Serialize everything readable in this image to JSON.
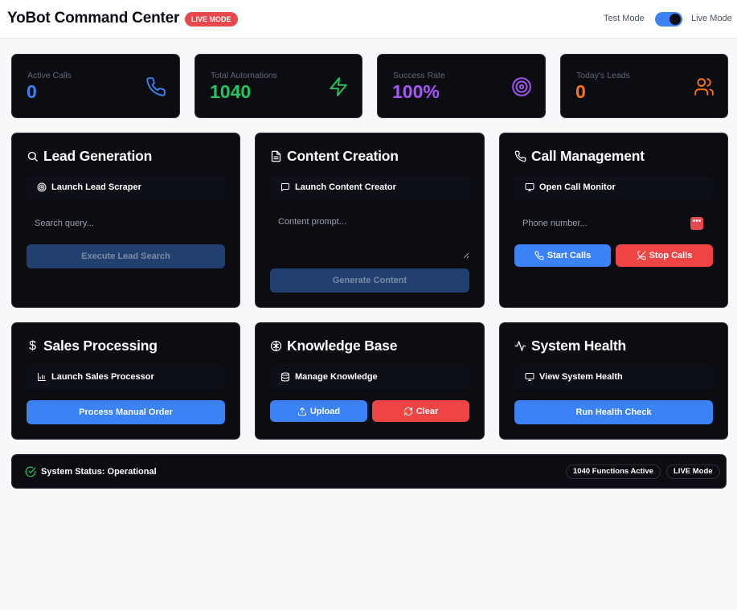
{
  "header": {
    "title": "YoBot Command Center",
    "badge": "LIVE MODE",
    "test_mode_label": "Test Mode",
    "live_mode_label": "Live Mode"
  },
  "stats": [
    {
      "label": "Active Calls",
      "value": "0",
      "color": "#3b82f6",
      "icon": "phone-icon"
    },
    {
      "label": "Total Automations",
      "value": "1040",
      "color": "#22c55e",
      "icon": "lightning-icon"
    },
    {
      "label": "Success Rate",
      "value": "100%",
      "color": "#a855f7",
      "icon": "target-icon"
    },
    {
      "label": "Today's Leads",
      "value": "0",
      "color": "#f97316",
      "icon": "users-icon"
    }
  ],
  "lead_generation": {
    "title": "Lead Generation",
    "launch": "Launch Lead Scraper",
    "search_placeholder": "Search query...",
    "execute": "Execute Lead Search"
  },
  "content_creation": {
    "title": "Content Creation",
    "launch": "Launch Content Creator",
    "prompt_placeholder": "Content prompt...",
    "generate": "Generate Content"
  },
  "call_management": {
    "title": "Call Management",
    "launch": "Open Call Monitor",
    "phone_placeholder": "Phone number...",
    "start": "Start Calls",
    "stop": "Stop Calls"
  },
  "sales_processing": {
    "title": "Sales Processing",
    "launch": "Launch Sales Processor",
    "process": "Process Manual Order"
  },
  "knowledge_base": {
    "title": "Knowledge Base",
    "launch": "Manage Knowledge",
    "upload": "Upload",
    "clear": "Clear"
  },
  "system_health": {
    "title": "System Health",
    "launch": "View System Health",
    "run": "Run Health Check"
  },
  "status_bar": {
    "status": "System Status: Operational",
    "functions": "1040 Functions Active",
    "mode": "LIVE Mode"
  }
}
